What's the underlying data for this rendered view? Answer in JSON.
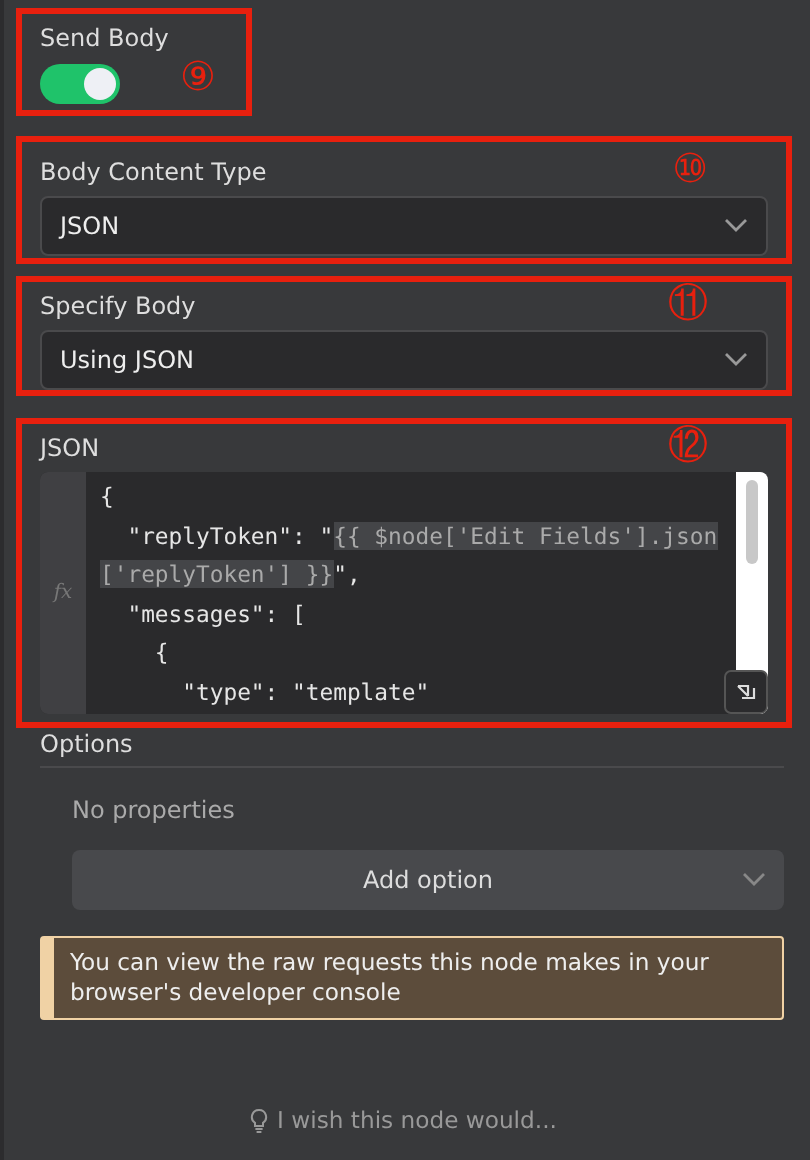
{
  "send_body": {
    "label": "Send Body",
    "on": true,
    "marker": "⑨"
  },
  "body_content_type": {
    "label": "Body Content Type",
    "value": "JSON",
    "marker": "⑩"
  },
  "specify_body": {
    "label": "Specify Body",
    "value": "Using JSON",
    "marker": "⑪"
  },
  "json_editor": {
    "label": "JSON",
    "gutter": "fx",
    "marker": "⑫",
    "lines": [
      {
        "segments": [
          {
            "text": "{",
            "kind": "plain"
          }
        ]
      },
      {
        "segments": [
          {
            "text": "  \"replyToken\": \"",
            "kind": "plain"
          },
          {
            "text": "{{ $node['Edit Fields'].json",
            "kind": "expr"
          }
        ]
      },
      {
        "segments": [
          {
            "text": "['replyToken'] }}",
            "kind": "expr"
          },
          {
            "text": "\",",
            "kind": "plain"
          }
        ]
      },
      {
        "segments": [
          {
            "text": "  \"messages\": [",
            "kind": "plain"
          }
        ]
      },
      {
        "segments": [
          {
            "text": "    {",
            "kind": "plain"
          }
        ]
      },
      {
        "segments": [
          {
            "text": "      \"type\": \"template\"",
            "kind": "plain"
          }
        ]
      }
    ]
  },
  "options": {
    "title": "Options",
    "empty_text": "No properties",
    "add_button": "Add option"
  },
  "notice": "You can view the raw requests this node makes in your browser's developer console",
  "feedback": "I wish this node would..."
}
